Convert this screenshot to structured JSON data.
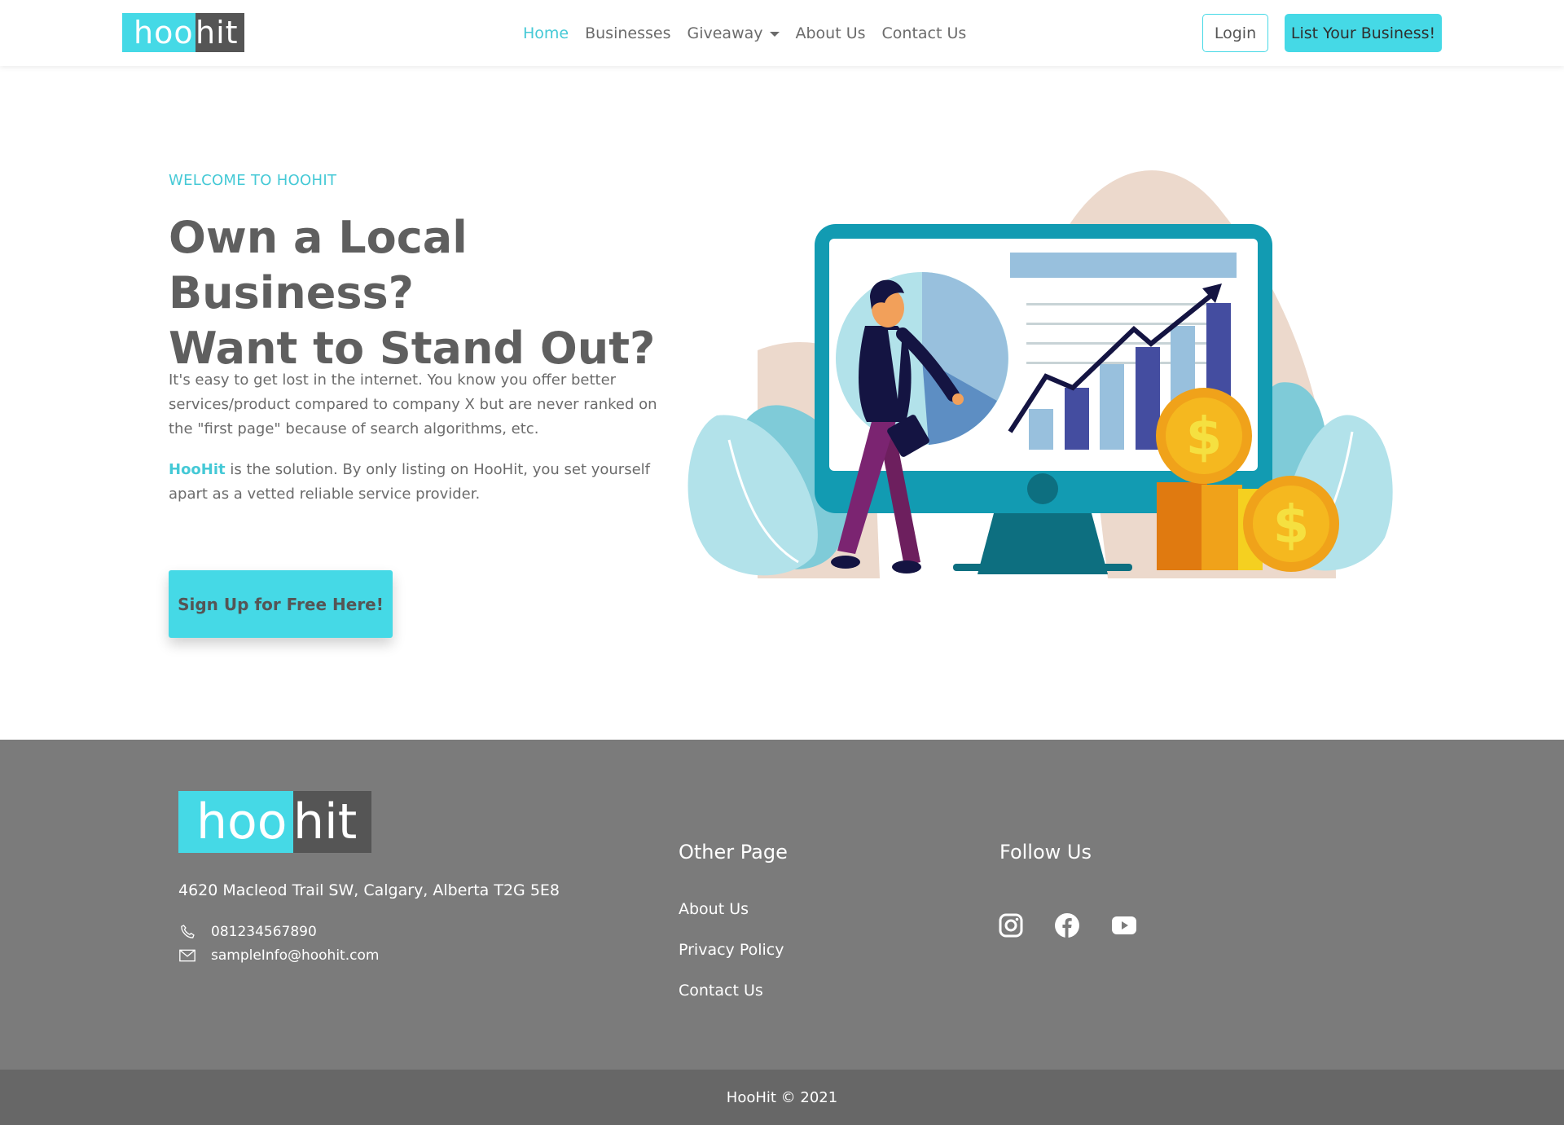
{
  "brand": {
    "logo_part1": "hoo",
    "logo_part2": "hit"
  },
  "nav": {
    "items": [
      {
        "label": "Home",
        "active": true
      },
      {
        "label": "Businesses"
      },
      {
        "label": "Giveaway",
        "has_dropdown": true
      },
      {
        "label": "About Us"
      },
      {
        "label": "Contact Us"
      }
    ],
    "login_label": "Login",
    "list_business_label": "List Your Business!"
  },
  "hero": {
    "eyebrow": "WELCOME TO HOOHIT",
    "title_line1": "Own a Local Business?",
    "title_line2": "Want to Stand Out?",
    "paragraph1": "It's easy to get lost in the internet. You know you offer better services/product compared to company X but are never ranked on the \"first page\" because of search algorithms, etc.",
    "paragraph2_highlight": "HooHit",
    "paragraph2_rest": " is the solution. By only listing on HooHit, you set yourself apart as a vetted reliable service provider.",
    "cta_label": "Sign Up for Free Here!",
    "illustration_icon": "business-growth-illustration"
  },
  "footer": {
    "address": "4620 Macleod Trail SW, Calgary, Alberta T2G 5E8",
    "phone": "081234567890",
    "email": "sampleInfo@hoohit.com",
    "other_page_title": "Other Page",
    "links": [
      "About Us",
      "Privacy Policy",
      "Contact Us"
    ],
    "follow_title": "Follow Us",
    "social": [
      "instagram-icon",
      "facebook-icon",
      "youtube-icon"
    ],
    "copyright": "HooHit © 2021"
  },
  "colors": {
    "accent": "#45d9e6",
    "footer_bg": "#7b7b7b",
    "copyright_bg": "#676767",
    "text": "#6b6b6b"
  }
}
